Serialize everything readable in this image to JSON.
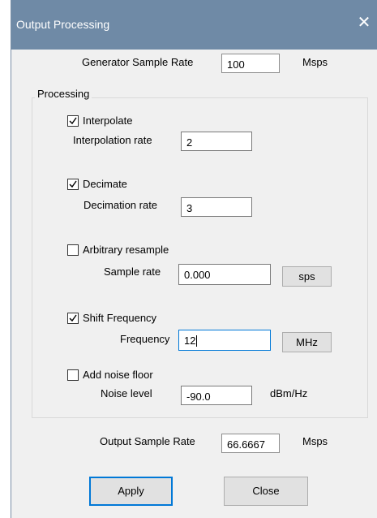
{
  "window": {
    "title": "Output Processing",
    "close_glyph": "✕"
  },
  "generator": {
    "label": "Generator Sample Rate",
    "value": "100",
    "unit": "Msps"
  },
  "processing": {
    "group_label": "Processing",
    "interpolate": {
      "label": "Interpolate",
      "checked": true,
      "rate_label": "Interpolation rate",
      "rate_value": "2"
    },
    "decimate": {
      "label": "Decimate",
      "checked": true,
      "rate_label": "Decimation rate",
      "rate_value": "3"
    },
    "arbitrary": {
      "label": "Arbitrary resample",
      "checked": false,
      "rate_label": "Sample rate",
      "rate_value": "0.000",
      "unit_button": "sps"
    },
    "shift": {
      "label": "Shift Frequency",
      "checked": true,
      "freq_label": "Frequency",
      "freq_value": "12",
      "unit_button": "MHz"
    },
    "noise": {
      "label": "Add noise floor",
      "checked": false,
      "level_label": "Noise level",
      "level_value": "-90.0",
      "unit": "dBm/Hz"
    }
  },
  "output": {
    "label": "Output Sample Rate",
    "value": "66.6667",
    "unit": "Msps"
  },
  "buttons": {
    "apply": "Apply",
    "close": "Close"
  },
  "icons": {
    "checkmark": "check-icon",
    "close": "close-icon"
  },
  "colors": {
    "titlebar": "#6f8aa6",
    "dialog_bg": "#f0f0f0",
    "focus_accent": "#0078d7"
  }
}
